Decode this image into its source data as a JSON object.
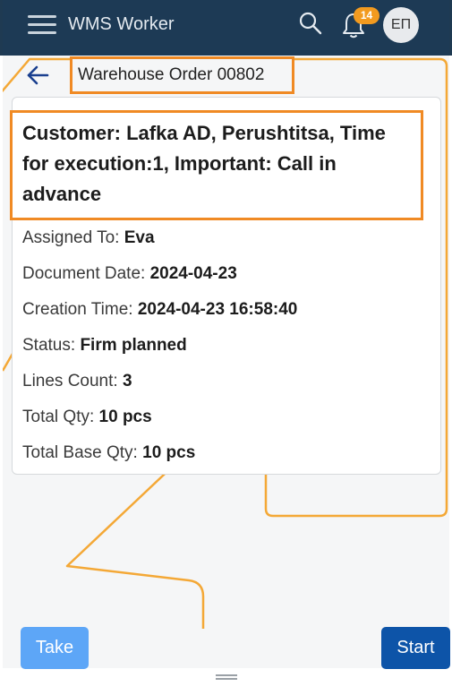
{
  "header": {
    "app_title": "WMS Worker",
    "notification_count": "14",
    "avatar_initials": "ЕП"
  },
  "order": {
    "title": "Warehouse Order 00802",
    "customer_info": "Customer: Lafka AD, Perushtitsa, Time for execution:1, Important: Call in advance",
    "fields": [
      {
        "label": "Assigned To:",
        "value": "Eva"
      },
      {
        "label": "Document Date:",
        "value": "2024-04-23"
      },
      {
        "label": "Creation Time:",
        "value": "2024-04-23 16:58:40"
      },
      {
        "label": "Status:",
        "value": "Firm planned"
      },
      {
        "label": "Lines Count:",
        "value": "3"
      },
      {
        "label": "Total Qty:",
        "value": "10 pcs"
      },
      {
        "label": "Total Base Qty:",
        "value": "10 pcs"
      }
    ]
  },
  "actions": {
    "take_label": "Take",
    "start_label": "Start"
  },
  "colors": {
    "appbar": "#1d3a55",
    "highlight": "#f08a24",
    "take_button": "#5da6f7",
    "start_button": "#0d54a8",
    "badge": "#f29a1f"
  }
}
